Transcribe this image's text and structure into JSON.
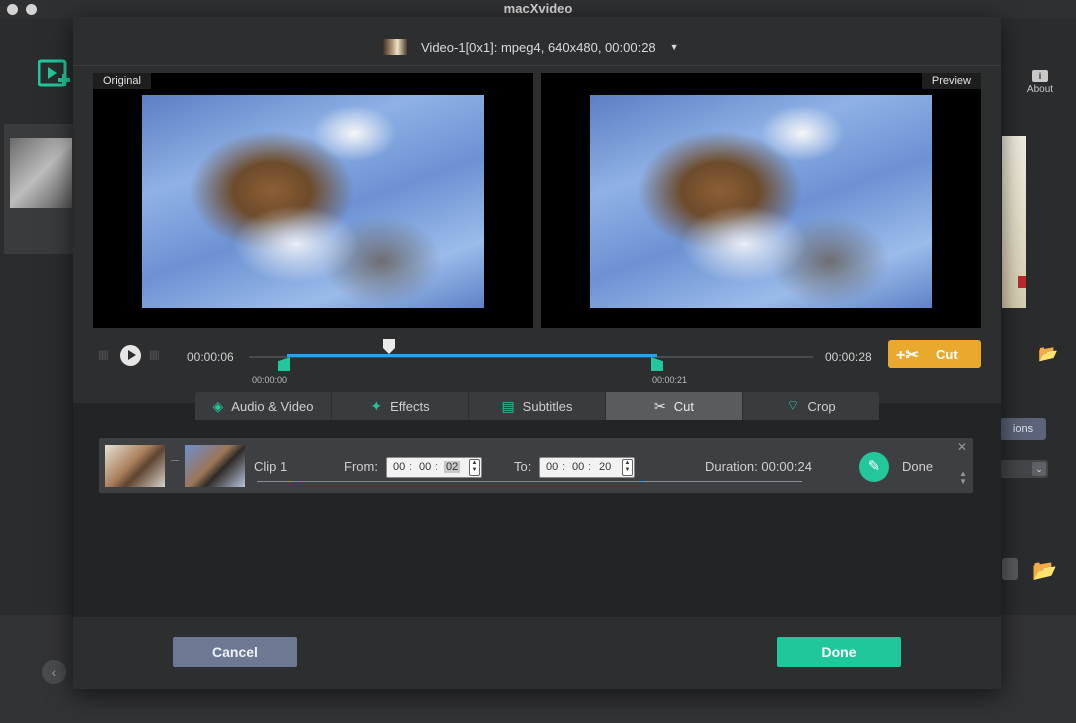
{
  "app_title": "macXvideo",
  "background": {
    "about_label": "About",
    "options_label": "ions"
  },
  "dialog": {
    "video_selector": "Video-1[0x1]: mpeg4, 640x480, 00:00:28",
    "original_label": "Original",
    "preview_label": "Preview",
    "timeline": {
      "current_time": "00:00:06",
      "end_time": "00:00:28",
      "start_marker": "00:00:00",
      "end_marker": "00:00:21",
      "cut_button": "Cut"
    },
    "tabs": [
      {
        "label": "Audio & Video",
        "icon": "audio-video-icon"
      },
      {
        "label": "Effects",
        "icon": "magic-wand-icon"
      },
      {
        "label": "Subtitles",
        "icon": "subtitles-icon"
      },
      {
        "label": "Cut",
        "icon": "scissors-icon",
        "active": true
      },
      {
        "label": "Crop",
        "icon": "crop-icon"
      }
    ],
    "clip": {
      "name": "Clip 1",
      "from_label": "From:",
      "from_hh": "00",
      "from_mm": "00",
      "from_ss": "02",
      "to_label": "To:",
      "to_hh": "00",
      "to_mm": "00",
      "to_ss": "20",
      "duration": "Duration: 00:00:24",
      "done_label": "Done"
    },
    "cancel_button": "Cancel",
    "done_button": "Done"
  },
  "colors": {
    "accent_green": "#1fc79a",
    "accent_orange": "#e9a92d",
    "selection_blue": "#27a3e8",
    "cancel_blue": "#6d7893"
  }
}
